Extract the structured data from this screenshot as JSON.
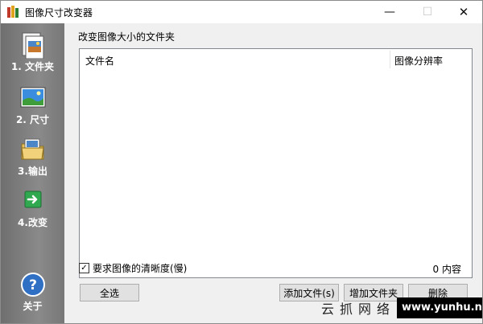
{
  "window": {
    "title": "图像尺寸改变器",
    "controls": {
      "minimize": "—",
      "maximize": "☐",
      "close": "✕"
    }
  },
  "sidebar": {
    "items": [
      {
        "label": "1. 文件夹",
        "icon": "document-image-icon"
      },
      {
        "label": "2. 尺寸",
        "icon": "landscape-picture-icon"
      },
      {
        "label": "3.输出",
        "icon": "folder-output-icon"
      },
      {
        "label": "4.改变",
        "icon": "green-arrow-icon"
      }
    ],
    "about": {
      "label": "关于",
      "icon": "help-icon",
      "glyph": "?"
    }
  },
  "main": {
    "group_title": "改变图像大小的文件夹",
    "table": {
      "columns": [
        "文件名",
        "图像分辨率"
      ],
      "rows": []
    },
    "quality_checkbox": {
      "label": "要求图像的清晰度(慢)",
      "checked": true,
      "glyph": "✓"
    },
    "count_text": "0 内容",
    "buttons": {
      "select_all": "全选",
      "add_file": "添加文件(s)",
      "add_folder": "增加文件夹",
      "delete": "删除"
    }
  },
  "watermark": {
    "chinese": "云抓网络",
    "url": "www.yunhu.net"
  }
}
